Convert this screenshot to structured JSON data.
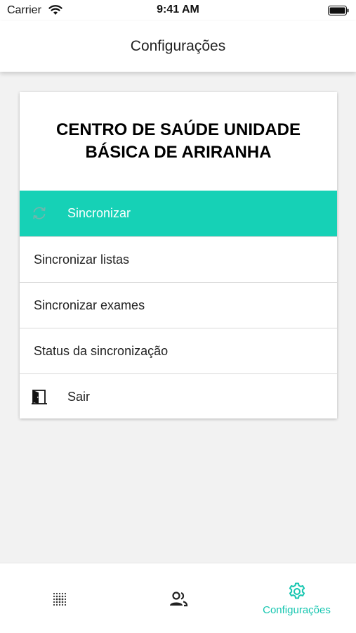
{
  "status_bar": {
    "carrier": "Carrier",
    "time": "9:41 AM"
  },
  "header": {
    "title": "Configurações"
  },
  "card": {
    "title": "CENTRO DE SAÚDE UNIDADE BÁSICA DE ARIRANHA",
    "menu": [
      {
        "label": "Sincronizar",
        "icon": "sync-icon",
        "active": true
      },
      {
        "label": "Sincronizar listas"
      },
      {
        "label": "Sincronizar exames"
      },
      {
        "label": "Status da sincronização"
      },
      {
        "label": "Sair",
        "icon": "door-exit-icon"
      }
    ]
  },
  "tab_bar": {
    "tabs": [
      {
        "icon": "fingerprint-dots-icon",
        "label": ""
      },
      {
        "icon": "people-icon",
        "label": ""
      },
      {
        "icon": "gear-icon",
        "label": "Configurações",
        "active": true
      }
    ]
  },
  "colors": {
    "accent": "#16d1b6",
    "tab_active": "#16c6b0"
  }
}
